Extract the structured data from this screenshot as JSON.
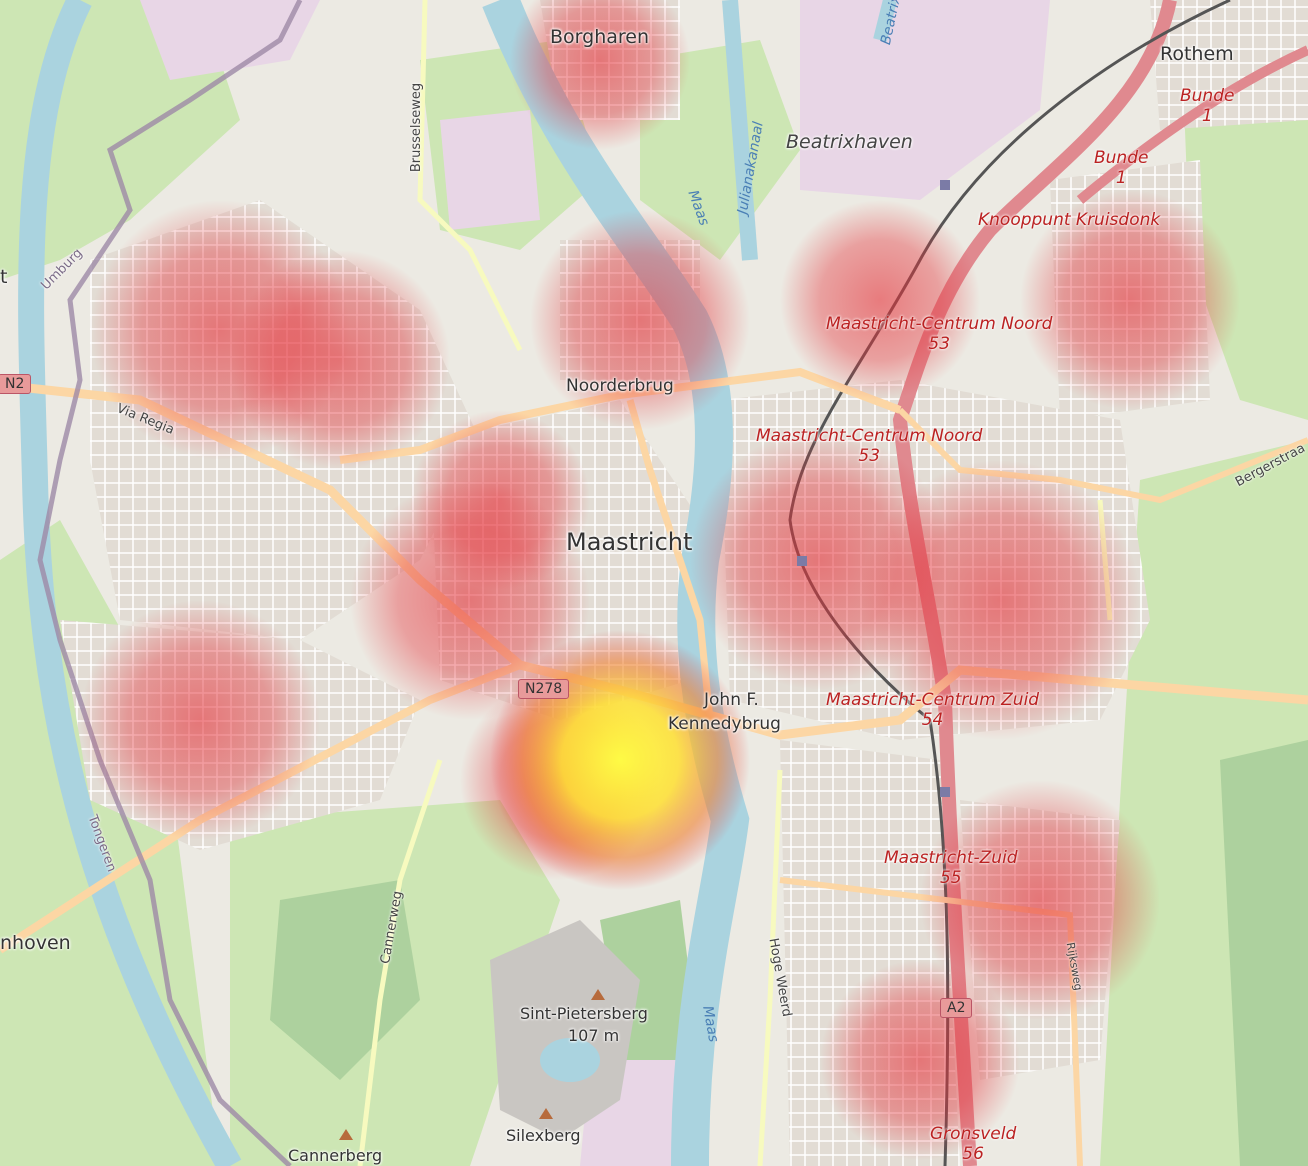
{
  "map": {
    "places": {
      "borgharen": "Borgharen",
      "rothem": "Rothem",
      "beatrixhaven": "Beatrixhaven",
      "maastricht": "Maastricht",
      "noorderbrug": "Noorderbrug",
      "kennedybrug_line1": "John F.",
      "kennedybrug_line2": "Kennedybrug",
      "sint_pietersberg": "Sint-Pietersberg",
      "sint_pietersberg_elev": "107 m",
      "silexberg": "Silexberg",
      "cannerberg": "Cannerberg",
      "lanaken_partial": "nhoven",
      "left_partial": "t"
    },
    "roads": {
      "brusselseweg": "Brusselseweg",
      "via_regia": "Via Regia",
      "cannerweg": "Cannerweg",
      "hoge_weerd": "Hoge Weerd",
      "rijksweg": "Rijksweg",
      "bergerstraat": "Bergerstraa",
      "umburg": "Umburg",
      "tongeren": "Tongeren"
    },
    "water": {
      "maas_north": "Maas",
      "julianakanaal": "Julianakanaal",
      "beatrix_basin": "Beatrix",
      "maas_south": "Maas"
    },
    "shields": {
      "n278": "N278",
      "n2": "N2",
      "a2": "A2"
    },
    "junctions": [
      {
        "name": "Bunde",
        "number": "1"
      },
      {
        "name": "Bunde",
        "number": "1"
      },
      {
        "name": "Knooppunt Kruisdonk",
        "number": ""
      },
      {
        "name": "Maastricht-Centrum Noord",
        "number": "53"
      },
      {
        "name": "Maastricht-Centrum Noord",
        "number": "53"
      },
      {
        "name": "Maastricht-Centrum Zuid",
        "number": "54"
      },
      {
        "name": "Maastricht-Zuid",
        "number": "55"
      },
      {
        "name": "Gronsveld",
        "number": "56"
      }
    ]
  }
}
